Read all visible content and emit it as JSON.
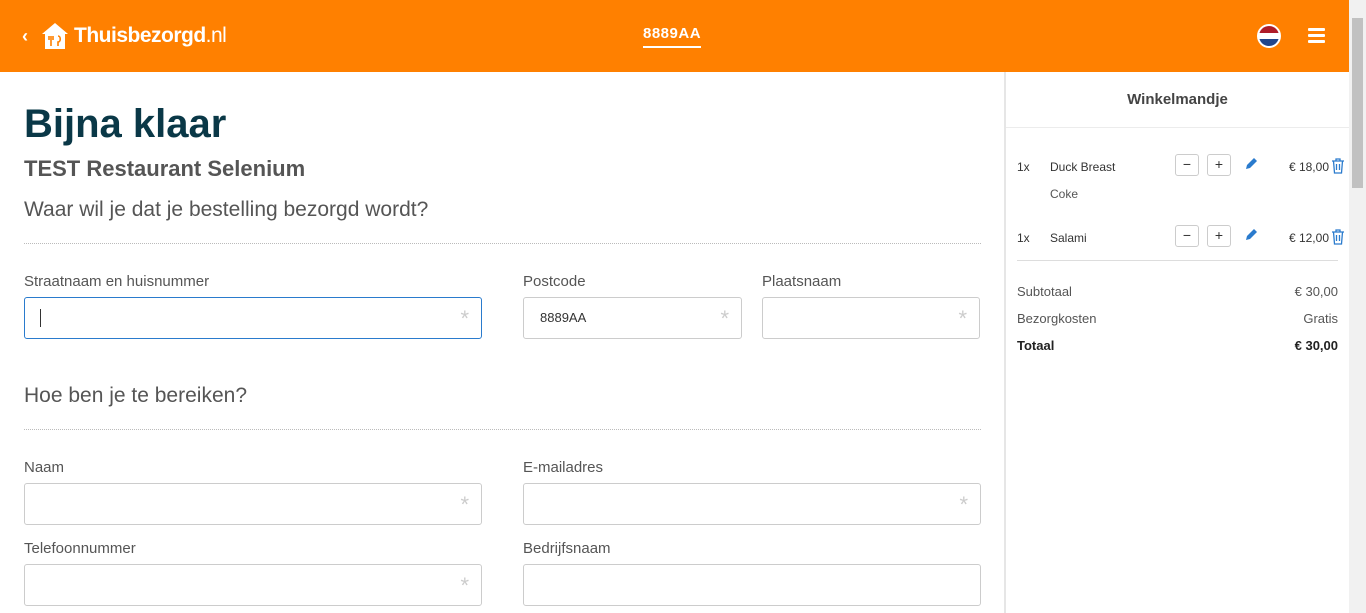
{
  "header": {
    "logo_main": "Thuisbezorgd",
    "logo_tld": ".nl",
    "postcode": "8889AA",
    "back_icon": "chevron-left-icon",
    "flag_icon": "netherlands-flag-icon",
    "menu_icon": "hamburger-menu-icon",
    "brand_color": "#ff8000"
  },
  "page": {
    "title": "Bijna klaar",
    "restaurant": "TEST Restaurant Selenium",
    "section_delivery": "Waar wil je dat je bestelling bezorgd wordt?",
    "section_contact": "Hoe ben je te bereiken?"
  },
  "form": {
    "street": {
      "label": "Straatnaam en huisnummer",
      "value": ""
    },
    "postcode": {
      "label": "Postcode",
      "value": "8889AA"
    },
    "city": {
      "label": "Plaatsnaam",
      "value": ""
    },
    "name": {
      "label": "Naam",
      "value": ""
    },
    "email": {
      "label": "E-mailadres",
      "value": ""
    },
    "phone": {
      "label": "Telefoonnummer",
      "value": ""
    },
    "company": {
      "label": "Bedrijfsnaam",
      "value": ""
    },
    "required_marker": "*"
  },
  "cart": {
    "title": "Winkelmandje",
    "items": [
      {
        "qty": "1x",
        "name": "Duck Breast",
        "option": "Coke",
        "price": "€ 18,00"
      },
      {
        "qty": "1x",
        "name": "Salami",
        "option": "",
        "price": "€ 12,00"
      }
    ],
    "minus": "−",
    "plus": "+",
    "subtotal_label": "Subtotaal",
    "subtotal_value": "€ 30,00",
    "delivery_label": "Bezorgkosten",
    "delivery_value": "Gratis",
    "total_label": "Totaal",
    "total_value": "€ 30,00",
    "accent_color": "#2a7bcd"
  }
}
